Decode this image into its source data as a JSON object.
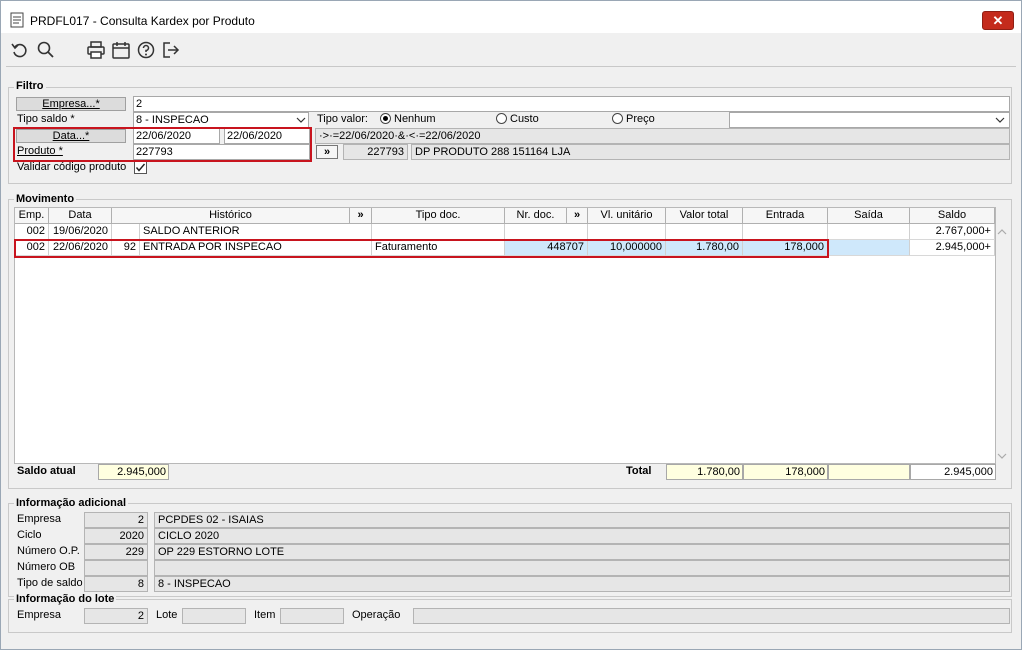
{
  "window": {
    "title": "PRDFL017 - Consulta Kardex por Produto",
    "close_glyph": "✕"
  },
  "toolbar": {
    "icons": [
      "undo-icon",
      "search-icon",
      "print-icon",
      "calendar-icon",
      "help-icon",
      "exit-icon"
    ]
  },
  "filtro": {
    "title": "Filtro",
    "empresa_label": "Empresa...*",
    "empresa_value": "2",
    "tipo_saldo_label": "Tipo saldo *",
    "tipo_saldo_value": "8 - INSPECAO",
    "tipo_valor_label": "Tipo valor:",
    "tipo_valor_options": [
      "Nenhum",
      "Custo",
      "Preço"
    ],
    "tipo_valor_selected": "Nenhum",
    "data_label": "Data...*",
    "data_inicio": "22/06/2020",
    "data_fim": "22/06/2020",
    "data_expr": "·>·=22/06/2020·&·<·=22/06/2020",
    "produto_label": "Produto *",
    "produto_value": "227793",
    "produto_btn": "»",
    "produto_code": "227793",
    "produto_desc": "DP PRODUTO 288 151164 LJA",
    "validar_label": "Validar código produto",
    "validar_checked": true
  },
  "movimento": {
    "title": "Movimento",
    "columns": [
      "Emp.",
      "Data",
      "Histórico",
      "»",
      "Tipo doc.",
      "Nr. doc.",
      "»",
      "Vl. unitário",
      "Valor total",
      "Entrada",
      "Saída",
      "Saldo"
    ],
    "rows": [
      {
        "emp": "002",
        "data": "19/06/2020",
        "seq": "",
        "historico": "SALDO ANTERIOR",
        "tipo_doc": "",
        "nr_doc": "",
        "vl_unit": "",
        "valor_total": "",
        "entrada": "",
        "saida": "",
        "saldo": "2.767,000+"
      },
      {
        "emp": "002",
        "data": "22/06/2020",
        "seq": "92",
        "historico": "ENTRADA POR INSPECAO",
        "tipo_doc": "Faturamento",
        "nr_doc": "448707",
        "vl_unit": "10,000000",
        "valor_total": "1.780,00",
        "entrada": "178,000",
        "saida": "",
        "saldo": "2.945,000+"
      }
    ],
    "saldo_atual_label": "Saldo atual",
    "saldo_atual_value": "2.945,000",
    "total_label": "Total",
    "total_valor": "1.780,00",
    "total_entrada": "178,000",
    "total_saida": "",
    "total_saldo": "2.945,000"
  },
  "info_adicional": {
    "title": "Informação adicional",
    "rows": [
      {
        "label": "Empresa",
        "code": "2",
        "desc": "PCPDES 02 - ISAIAS"
      },
      {
        "label": "Ciclo",
        "code": "2020",
        "desc": "CICLO 2020"
      },
      {
        "label": "Número O.P.",
        "code": "229",
        "desc": "OP 229 ESTORNO LOTE"
      },
      {
        "label": "Número OB",
        "code": "",
        "desc": ""
      },
      {
        "label": "Tipo de saldo",
        "code": "8",
        "desc": "8 - INSPECAO"
      }
    ]
  },
  "info_lote": {
    "title": "Informação do lote",
    "empresa_label": "Empresa",
    "empresa_value": "2",
    "lote_label": "Lote",
    "lote_value": "",
    "item_label": "Item",
    "item_value": "",
    "operacao_label": "Operação",
    "operacao_value": ""
  },
  "colors": {
    "highlight_red": "#c8141e",
    "selection_blue": "#cfe8fb",
    "total_yellow": "#ffffe0",
    "close_red": "#c42b1c"
  }
}
